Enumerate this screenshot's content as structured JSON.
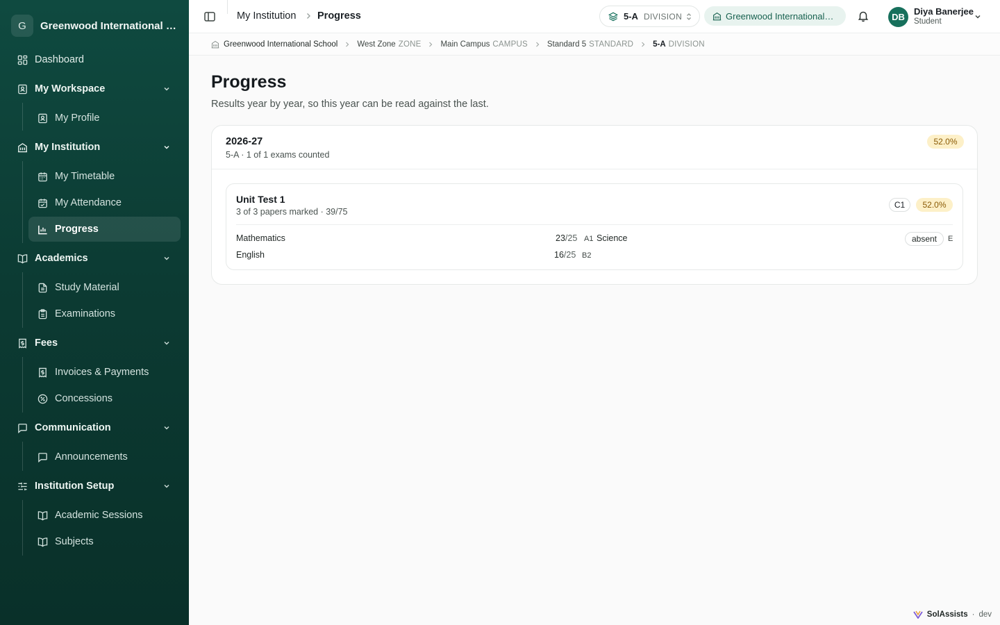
{
  "sidebar": {
    "logo_letter": "G",
    "institution_name": "Greenwood International Sc...",
    "items": {
      "dashboard": "Dashboard",
      "my_workspace": "My Workspace",
      "my_profile": "My Profile",
      "my_institution": "My Institution",
      "my_timetable": "My Timetable",
      "my_attendance": "My Attendance",
      "progress": "Progress",
      "academics": "Academics",
      "study_material": "Study Material",
      "examinations": "Examinations",
      "fees": "Fees",
      "invoices_payments": "Invoices & Payments",
      "concessions": "Concessions",
      "communication": "Communication",
      "announcements": "Announcements",
      "institution_setup": "Institution Setup",
      "academic_sessions": "Academic Sessions",
      "subjects": "Subjects"
    },
    "active_item": "progress"
  },
  "topbar": {
    "crumb_parent": "My Institution",
    "crumb_current": "Progress",
    "division_code": "5-A",
    "division_kind": "DIVISION",
    "school_pill": "Greenwood International S...",
    "user_initials": "DB",
    "user_name": "Diya Banerjee",
    "user_role": "Student"
  },
  "context": {
    "school": "Greenwood International School",
    "zone_value": "West Zone",
    "zone_kind": "ZONE",
    "campus_value": "Main Campus",
    "campus_kind": "CAMPUS",
    "standard_value": "Standard 5",
    "standard_kind": "STANDARD",
    "division_value": "5-A",
    "division_kind": "DIVISION"
  },
  "page": {
    "title": "Progress",
    "subtitle": "Results year by year, so this year can be read against the last."
  },
  "year_card": {
    "year": "2026-27",
    "meta": "5-A · 1 of 1 exams counted",
    "percent": "52.0%",
    "exam": {
      "name": "Unit Test 1",
      "meta": "3 of 3 papers marked · 39/75",
      "grade": "C1",
      "percent": "52.0%",
      "results": [
        {
          "subject": "Mathematics",
          "score": "23",
          "total": "/25",
          "grade": "A1"
        },
        {
          "subject": "English",
          "score": "16",
          "total": "/25",
          "grade": "B2"
        },
        {
          "subject": "Science",
          "status": "absent",
          "grade": "E"
        }
      ]
    }
  },
  "footer": {
    "brand": "SolAssists",
    "separator": "·",
    "env": "dev"
  },
  "colors": {
    "sidebar_bg": "#0c3b33",
    "accent": "#17705c",
    "badge_bg": "#fdf0c8",
    "badge_text": "#8a5a05"
  }
}
